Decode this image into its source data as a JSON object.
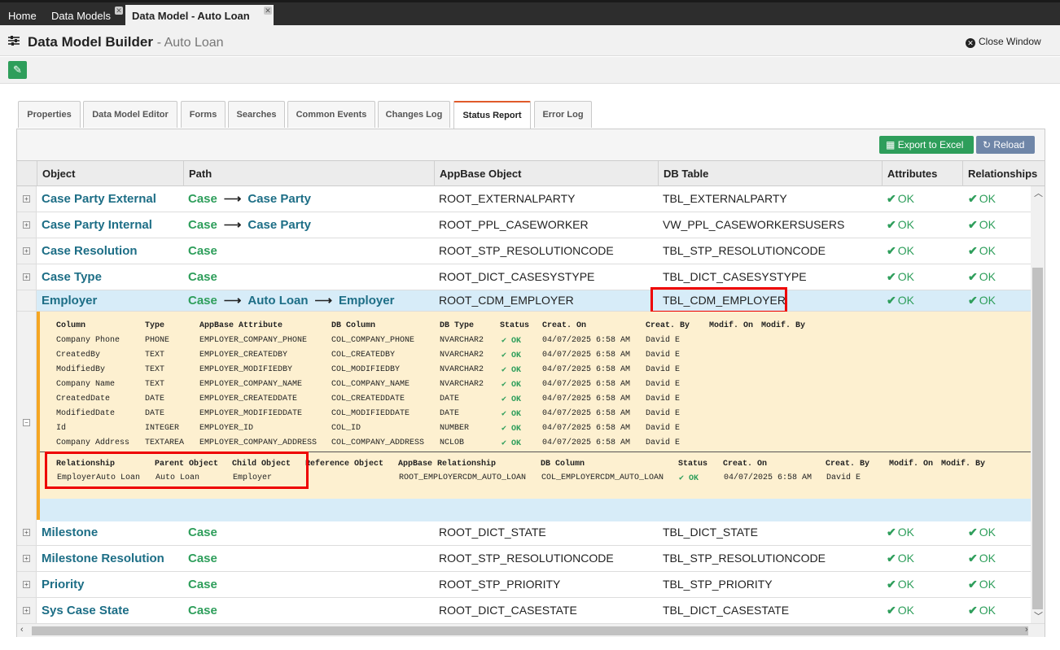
{
  "tabs": {
    "home": "Home",
    "models": "Data Models",
    "model": "Data Model - Auto Loan"
  },
  "header": {
    "title": "Data Model Builder",
    "subtitle": "- Auto Loan",
    "close": "Close Window"
  },
  "page_tabs": [
    "Properties",
    "Data Model Editor",
    "Forms",
    "Searches",
    "Common Events",
    "Changes Log",
    "Status Report",
    "Error Log"
  ],
  "active_tab": "Status Report",
  "toolbar": {
    "export": "Export to Excel",
    "reload": "Reload"
  },
  "columns": [
    "Object",
    "Path",
    "AppBase Object",
    "DB Table",
    "Attributes",
    "Relationships"
  ],
  "ok": "OK",
  "rows": [
    {
      "obj": "Case Party External",
      "path": [
        "Case",
        "Case Party"
      ],
      "ab": "ROOT_EXTERNALPARTY",
      "db": "TBL_EXTERNALPARTY"
    },
    {
      "obj": "Case Party Internal",
      "path": [
        "Case",
        "Case Party"
      ],
      "ab": "ROOT_PPL_CASEWORKER",
      "db": "VW_PPL_CASEWORKERSUSERS"
    },
    {
      "obj": "Case Resolution",
      "path": [
        "Case"
      ],
      "ab": "ROOT_STP_RESOLUTIONCODE",
      "db": "TBL_STP_RESOLUTIONCODE"
    },
    {
      "obj": "Case Type",
      "path": [
        "Case"
      ],
      "ab": "ROOT_DICT_CASESYSTYPE",
      "db": "TBL_DICT_CASESYSTYPE"
    },
    {
      "obj": "Employer",
      "path": [
        "Case",
        "Auto Loan",
        "Employer"
      ],
      "ab": "ROOT_CDM_EMPLOYER",
      "db": "TBL_CDM_EMPLOYER"
    },
    {
      "obj": "Milestone",
      "path": [
        "Case"
      ],
      "ab": "ROOT_DICT_STATE",
      "db": "TBL_DICT_STATE"
    },
    {
      "obj": "Milestone Resolution",
      "path": [
        "Case"
      ],
      "ab": "ROOT_STP_RESOLUTIONCODE",
      "db": "TBL_STP_RESOLUTIONCODE"
    },
    {
      "obj": "Priority",
      "path": [
        "Case"
      ],
      "ab": "ROOT_STP_PRIORITY",
      "db": "TBL_STP_PRIORITY"
    },
    {
      "obj": "Sys Case State",
      "path": [
        "Case"
      ],
      "ab": "ROOT_DICT_CASESTATE",
      "db": "TBL_DICT_CASESTATE"
    }
  ],
  "detail": {
    "attr_headers": [
      "Column",
      "Type",
      "AppBase Attribute",
      "DB Column",
      "DB Type",
      "Status",
      "Creat. On",
      "Creat. By",
      "Modif. On",
      "Modif. By"
    ],
    "attrs": [
      [
        "Company Phone",
        "PHONE",
        "EMPLOYER_COMPANY_PHONE",
        "COL_COMPANY_PHONE",
        "NVARCHAR2",
        "OK",
        "04/07/2025 6:58 AM",
        "David E"
      ],
      [
        "CreatedBy",
        "TEXT",
        "EMPLOYER_CREATEDBY",
        "COL_CREATEDBY",
        "NVARCHAR2",
        "OK",
        "04/07/2025 6:58 AM",
        "David E"
      ],
      [
        "ModifiedBy",
        "TEXT",
        "EMPLOYER_MODIFIEDBY",
        "COL_MODIFIEDBY",
        "NVARCHAR2",
        "OK",
        "04/07/2025 6:58 AM",
        "David E"
      ],
      [
        "Company Name",
        "TEXT",
        "EMPLOYER_COMPANY_NAME",
        "COL_COMPANY_NAME",
        "NVARCHAR2",
        "OK",
        "04/07/2025 6:58 AM",
        "David E"
      ],
      [
        "CreatedDate",
        "DATE",
        "EMPLOYER_CREATEDDATE",
        "COL_CREATEDDATE",
        "DATE",
        "OK",
        "04/07/2025 6:58 AM",
        "David E"
      ],
      [
        "ModifiedDate",
        "DATE",
        "EMPLOYER_MODIFIEDDATE",
        "COL_MODIFIEDDATE",
        "DATE",
        "OK",
        "04/07/2025 6:58 AM",
        "David E"
      ],
      [
        "Id",
        "INTEGER",
        "EMPLOYER_ID",
        "COL_ID",
        "NUMBER",
        "OK",
        "04/07/2025 6:58 AM",
        "David E"
      ],
      [
        "Company Address",
        "TEXTAREA",
        "EMPLOYER_COMPANY_ADDRESS",
        "COL_COMPANY_ADDRESS",
        "NCLOB",
        "OK",
        "04/07/2025 6:58 AM",
        "David E"
      ]
    ],
    "rel_headers": [
      "Relationship",
      "Parent Object",
      "Child Object",
      "Reference Object",
      "AppBase Relationship",
      "DB Column",
      "Status",
      "Creat. On",
      "Creat. By",
      "Modif. On",
      "Modif. By"
    ],
    "rels": [
      [
        "EmployerAuto Loan",
        "Auto Loan",
        "Employer",
        "",
        "ROOT_EMPLOYERCDM_AUTO_LOAN",
        "COL_EMPLOYERCDM_AUTO_LOAN",
        "OK",
        "04/07/2025 6:58 AM",
        "David E"
      ]
    ]
  }
}
